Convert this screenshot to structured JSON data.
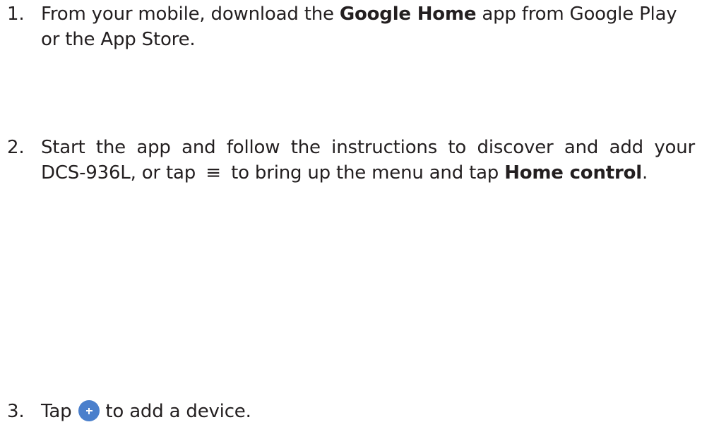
{
  "steps": [
    {
      "number": "1.",
      "line1_pre": "From your mobile, download the ",
      "line1_bold": "Google Home",
      "line1_post": " app from Google Play",
      "line2": "or the App Store."
    },
    {
      "number": "2.",
      "line1": "Start the app and follow the instructions to discover and add your",
      "line2_pre": "DCS-936L, or tap",
      "menu_glyph": "≡",
      "line2_mid": " to bring up the menu and tap ",
      "line2_bold": "Home control",
      "line2_end": "."
    },
    {
      "number": "3.",
      "pre": "Tap",
      "post": "to add a device."
    }
  ],
  "icons": {
    "menu": "menu-icon",
    "add": "add-circle-icon"
  },
  "colors": {
    "text": "#231f20",
    "add_button": "#4a7fcc"
  }
}
